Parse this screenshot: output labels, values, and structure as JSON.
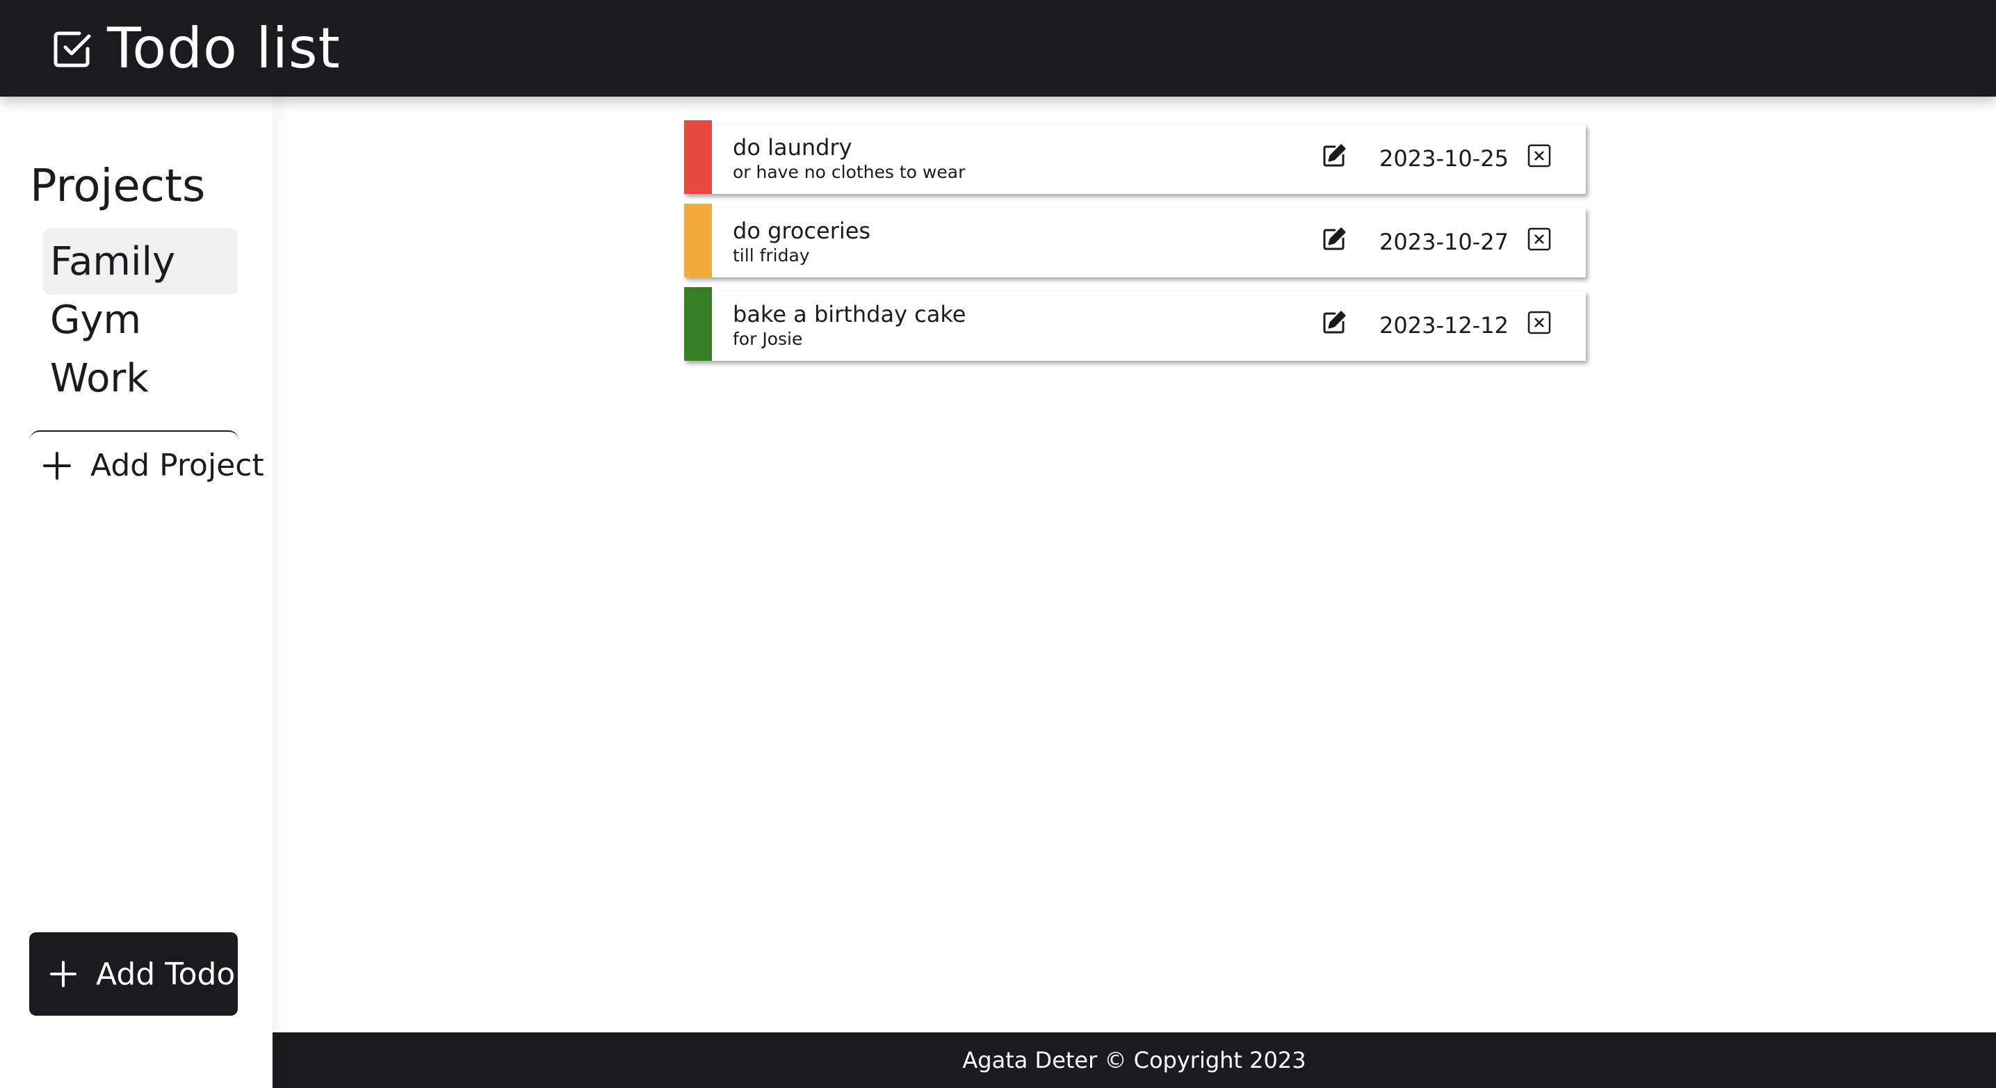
{
  "header": {
    "title": "Todo list",
    "icon": "checkbox-icon"
  },
  "sidebar": {
    "projects_title": "Projects",
    "projects": [
      {
        "label": "Family",
        "active": true
      },
      {
        "label": "Gym",
        "active": false
      },
      {
        "label": "Work",
        "active": false
      }
    ],
    "add_project_label": "Add Project",
    "add_todo_label": "Add Todo"
  },
  "todos": [
    {
      "title": "do laundry",
      "description": "or have no clothes to wear",
      "date": "2023-10-25",
      "priority_color": "#e54a3d"
    },
    {
      "title": "do groceries",
      "description": "till friday",
      "date": "2023-10-27",
      "priority_color": "#f2aa3b"
    },
    {
      "title": "bake a birthday cake",
      "description": "for Josie",
      "date": "2023-12-12",
      "priority_color": "#357f25"
    }
  ],
  "footer": {
    "text": "Agata Deter © Copyright 2023"
  },
  "colors": {
    "dark": "#1b1b1d",
    "active_project_bg": "#f1f1f1"
  }
}
